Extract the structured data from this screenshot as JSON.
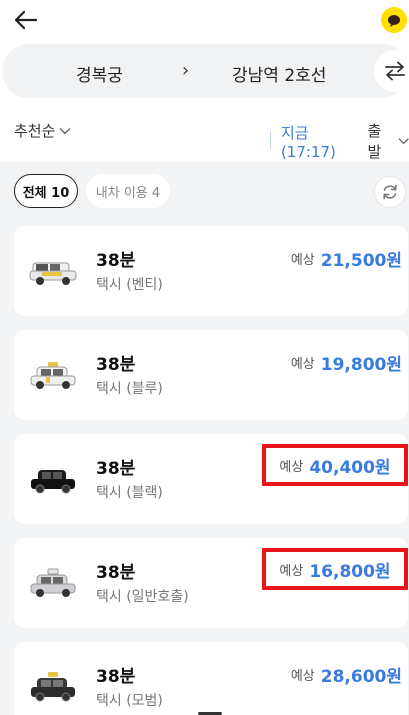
{
  "route": {
    "from": "경복궁",
    "arrow": "›",
    "to": "강남역 2호선"
  },
  "filters": {
    "sort_label": "추천순",
    "time_now": "지금 (17:17)",
    "time_depart": "출발"
  },
  "tabs": {
    "all": "전체 10",
    "history": "내차 이용 4"
  },
  "price_prefix": "예상",
  "colors": {
    "accent_blue": "#3a7be0",
    "highlight_red": "#e8161b",
    "chat_yellow": "#ffe000"
  },
  "results": [
    {
      "eta": "38분",
      "type": "택시 (벤티)",
      "price": "21,500원",
      "icon": "taxi-venti-icon",
      "highlighted": false
    },
    {
      "eta": "38분",
      "type": "택시 (블루)",
      "price": "19,800원",
      "icon": "taxi-blue-icon",
      "highlighted": false
    },
    {
      "eta": "38분",
      "type": "택시 (블랙)",
      "price": "40,400원",
      "icon": "taxi-black-icon",
      "highlighted": true
    },
    {
      "eta": "38분",
      "type": "택시 (일반호출)",
      "price": "16,800원",
      "icon": "taxi-general-icon",
      "highlighted": true
    },
    {
      "eta": "38분",
      "type": "택시 (모범)",
      "price": "28,600원",
      "icon": "taxi-deluxe-icon",
      "highlighted": false
    }
  ]
}
